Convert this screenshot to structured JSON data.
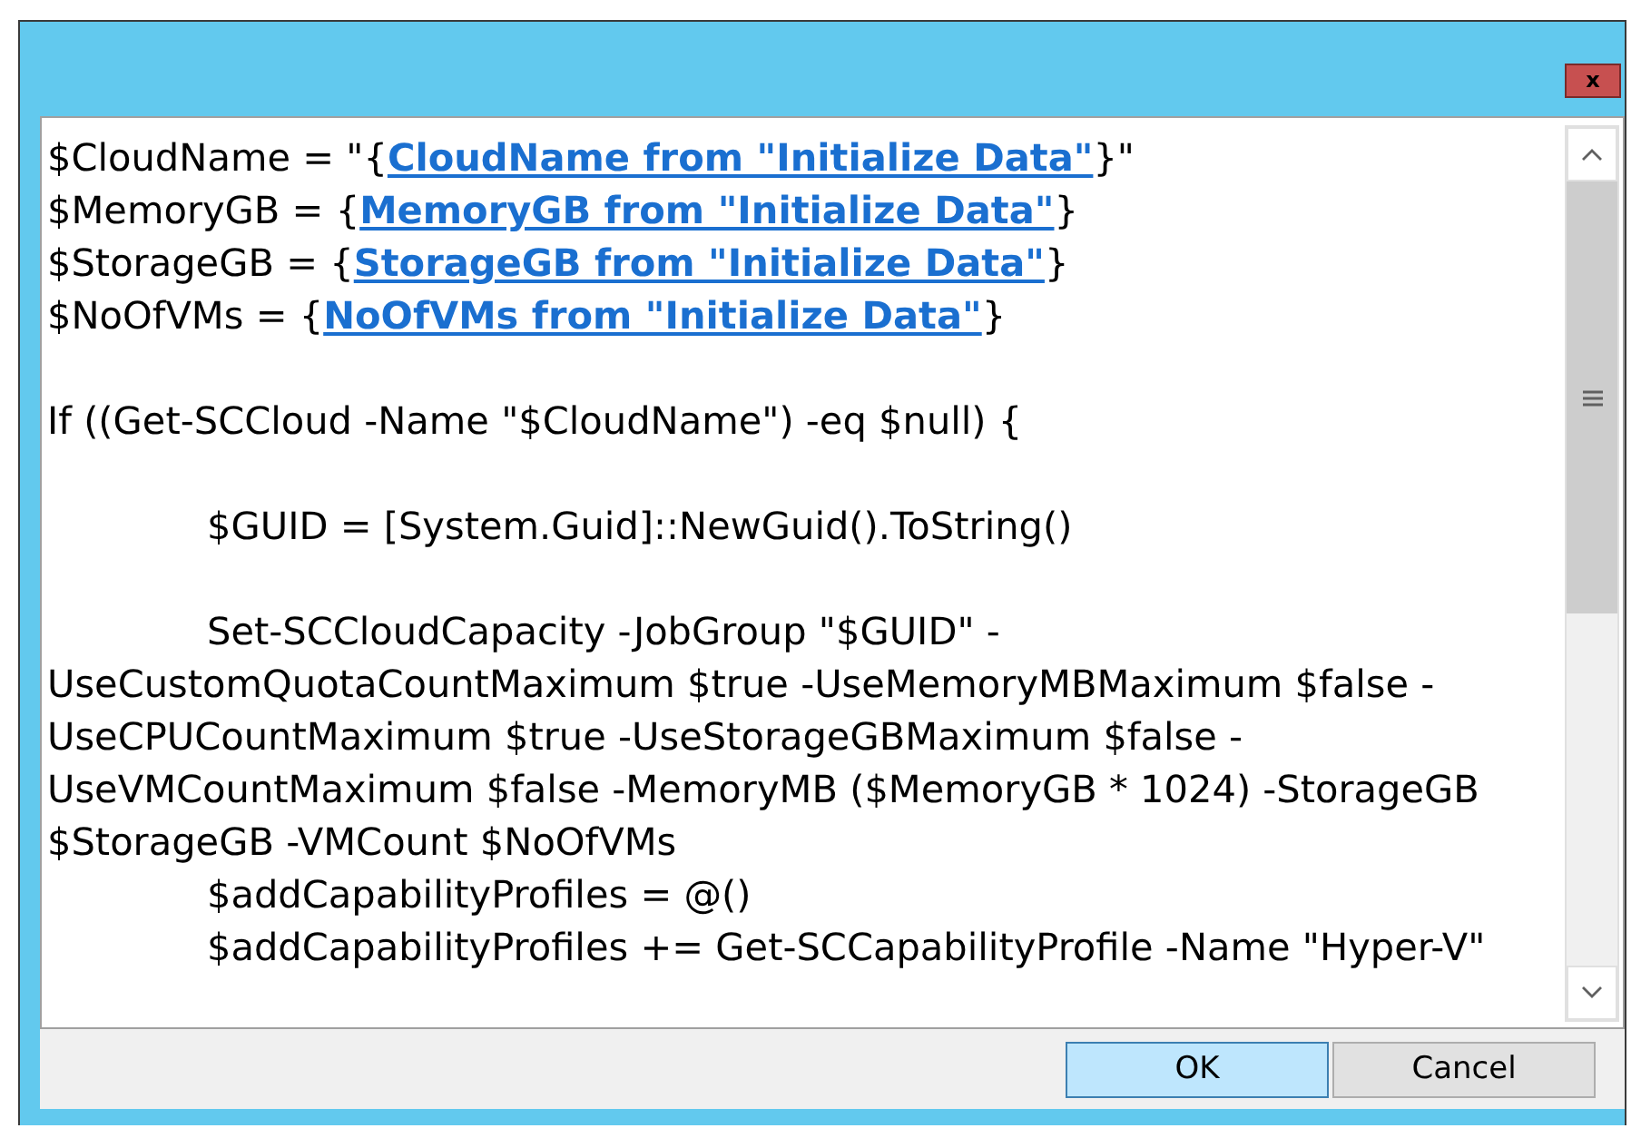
{
  "window": {
    "close_label": "x"
  },
  "editor": {
    "lines": [
      {
        "kind": "assign",
        "prefix": "$CloudName = \"{",
        "link": "CloudName from \"Initialize Data\"",
        "suffix": "}\""
      },
      {
        "kind": "assign",
        "prefix": "$MemoryGB = {",
        "link": "MemoryGB from \"Initialize Data\"",
        "suffix": "}"
      },
      {
        "kind": "assign",
        "prefix": "$StorageGB = {",
        "link": "StorageGB from \"Initialize Data\"",
        "suffix": "}"
      },
      {
        "kind": "assign",
        "prefix": "$NoOfVMs = {",
        "link": "NoOfVMs from \"Initialize Data\"",
        "suffix": "}"
      },
      {
        "kind": "blank"
      },
      {
        "kind": "text",
        "indent": false,
        "text": "If ((Get-SCCloud -Name \"$CloudName\") -eq $null) {"
      },
      {
        "kind": "blank"
      },
      {
        "kind": "text",
        "indent": true,
        "text": "$GUID = [System.Guid]::NewGuid().ToString()"
      },
      {
        "kind": "blank"
      },
      {
        "kind": "text",
        "indent": true,
        "text": "Set-SCCloudCapacity -JobGroup \"$GUID\" -"
      },
      {
        "kind": "text",
        "indent": false,
        "text": "UseCustomQuotaCountMaximum $true -UseMemoryMBMaximum $false -"
      },
      {
        "kind": "text",
        "indent": false,
        "text": "UseCPUCountMaximum $true -UseStorageGBMaximum $false -"
      },
      {
        "kind": "text",
        "indent": false,
        "text": "UseVMCountMaximum $false -MemoryMB ($MemoryGB * 1024) -StorageGB"
      },
      {
        "kind": "text",
        "indent": false,
        "text": "$StorageGB -VMCount $NoOfVMs"
      },
      {
        "kind": "text",
        "indent": true,
        "text": "$addCapabilityProfiles = @()"
      },
      {
        "kind": "text",
        "indent": true,
        "text": "$addCapabilityProfiles += Get-SCCapabilityProfile -Name \"Hyper-V\""
      }
    ]
  },
  "buttons": [
    {
      "label": "OK",
      "default": true
    },
    {
      "label": "Cancel",
      "default": false
    }
  ]
}
